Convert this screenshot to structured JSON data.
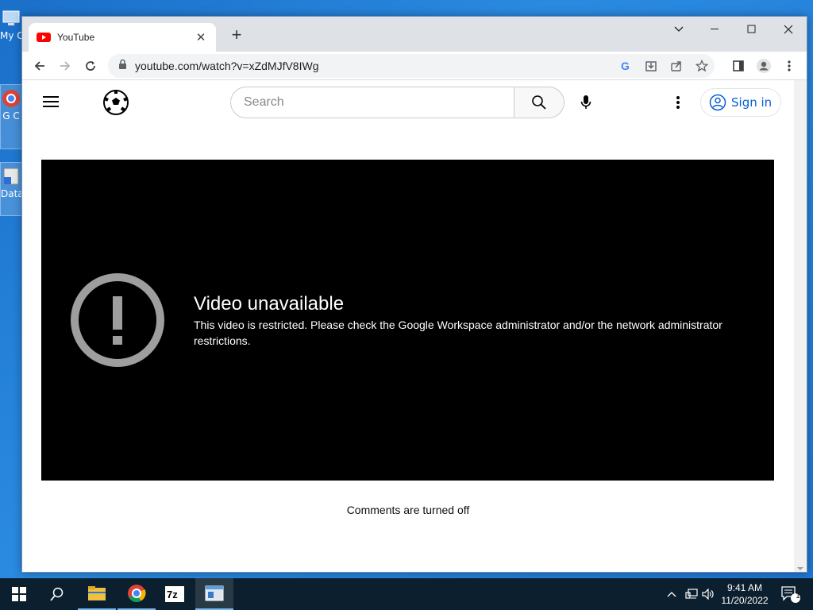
{
  "desktop": {
    "icons": [
      {
        "label": "My C",
        "icon": "this-pc-icon"
      },
      {
        "label": "G C",
        "icon": "google-chrome-shortcut-icon"
      },
      {
        "label": "Data",
        "icon": "data-shortcut-icon"
      }
    ]
  },
  "browser": {
    "tab": {
      "title": "YouTube",
      "favicon": "youtube-favicon-icon"
    },
    "address": {
      "url": "youtube.com/watch?v=xZdMJfV8IWg"
    }
  },
  "youtube": {
    "search": {
      "placeholder": "Search"
    },
    "signin_label": "Sign in",
    "error": {
      "title": "Video unavailable",
      "message": "This video is restricted. Please check the Google Workspace administrator and/or the network administrator restrictions."
    },
    "comments_status": "Comments are turned off"
  },
  "taskbar": {
    "apps": [
      "start-icon",
      "search-icon",
      "file-explorer-icon",
      "chrome-icon",
      "7zip-icon",
      "app-window-icon"
    ],
    "clock": {
      "time": "9:41 AM",
      "date": "11/20/2022"
    },
    "notification_count": "1"
  },
  "colors": {
    "youtube_red": "#ff0000",
    "link_blue": "#065fd4",
    "player_bg": "#000000",
    "desktop_blue": "#1f77d2"
  }
}
